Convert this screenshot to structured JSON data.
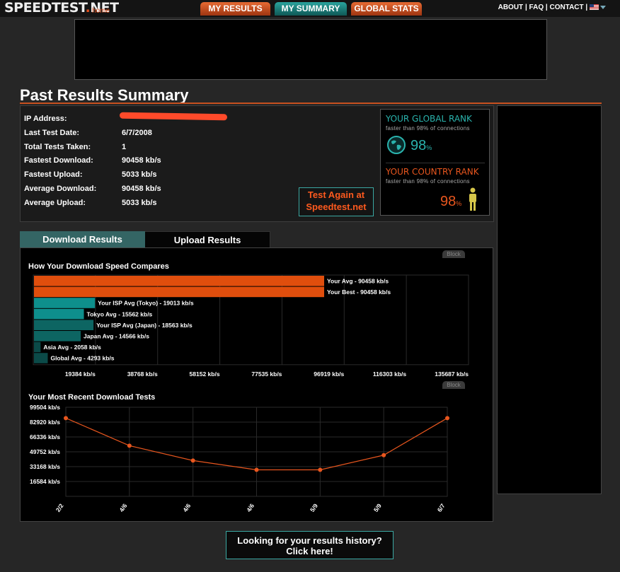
{
  "header": {
    "logo_main": "SPEEDTEST",
    "logo_dot": ".",
    "logo_suffix": "NET",
    "logo_home": "home",
    "tabs": [
      {
        "label": "MY RESULTS"
      },
      {
        "label": "MY SUMMARY"
      },
      {
        "label": "GLOBAL STATS"
      }
    ],
    "links": [
      "ABOUT",
      "FAQ",
      "CONTACT"
    ],
    "separator": "|",
    "flag_icon": "us-flag-icon"
  },
  "page_title": "Past Results Summary",
  "summary": {
    "rows": [
      {
        "label": "IP Address:",
        "value": ""
      },
      {
        "label": "Last Test Date:",
        "value": "6/7/2008"
      },
      {
        "label": "Total Tests Taken:",
        "value": "1"
      },
      {
        "label": "Fastest Download:",
        "value": "90458 kb/s"
      },
      {
        "label": "Fastest Upload:",
        "value": "5033 kb/s"
      },
      {
        "label": "Average Download:",
        "value": "90458 kb/s"
      },
      {
        "label": "Average Upload:",
        "value": "5033 kb/s"
      }
    ],
    "test_again_line1": "Test Again at",
    "test_again_line2": "Speedtest.net"
  },
  "global_rank": {
    "title": "YOUR GLOBAL RANK",
    "subtitle": "faster than 98% of connections",
    "value": "98",
    "unit": "%",
    "color": "#2ab3ad"
  },
  "country_rank": {
    "title": "YOUR COUNTRY RANK",
    "subtitle": "faster than 98% of connections",
    "value": "98",
    "unit": "%",
    "color": "#e8561e"
  },
  "results_tabs": [
    {
      "label": "Download Results",
      "active": true
    },
    {
      "label": "Upload Results",
      "active": false
    }
  ],
  "block_label": "Block",
  "compare_chart": {
    "title": "How Your Download Speed Compares",
    "xmax": 135687,
    "ticks": [
      "19384 kb/s",
      "38768 kb/s",
      "58152 kb/s",
      "77535 kb/s",
      "96919 kb/s",
      "116303 kb/s",
      "135687 kb/s"
    ],
    "bars": [
      {
        "label": "Your Avg - 90458 kb/s",
        "value": 90458,
        "color": "#e04e0d"
      },
      {
        "label": "Your Best - 90458 kb/s",
        "value": 90458,
        "color": "#e04e0d"
      },
      {
        "label": "Your ISP Avg (Tokyo) - 19013 kb/s",
        "value": 19013,
        "color": "#0e8f8c"
      },
      {
        "label": "Tokyo Avg - 15562 kb/s",
        "value": 15562,
        "color": "#0e8f8c"
      },
      {
        "label": "Your ISP Avg (Japan) - 18563 kb/s",
        "value": 18563,
        "color": "#0d6562"
      },
      {
        "label": "Japan Avg - 14566 kb/s",
        "value": 14566,
        "color": "#0d6562"
      },
      {
        "label": "Asia Avg - 2058 kb/s",
        "value": 2058,
        "color": "#0b4a48"
      },
      {
        "label": "Global Avg - 4293 kb/s",
        "value": 4293,
        "color": "#0b4a48"
      }
    ]
  },
  "chart_data": {
    "type": "line",
    "title": "Your Most Recent Download Tests",
    "x": [
      "2/2",
      "4/6",
      "4/6",
      "4/6",
      "5/9",
      "5/9",
      "6/7"
    ],
    "series": [
      {
        "values": [
          87400,
          56600,
          40000,
          29600,
          29600,
          46000,
          87400
        ],
        "color": "#e8561e"
      }
    ],
    "yticks": [
      "99504 kb/s",
      "82920 kb/s",
      "66336 kb/s",
      "49752 kb/s",
      "33168 kb/s",
      "16584 kb/s"
    ],
    "ylim": [
      0,
      99504
    ],
    "grid": true
  },
  "history": {
    "line1": "Looking for your results history?",
    "line2": "Click here!"
  }
}
